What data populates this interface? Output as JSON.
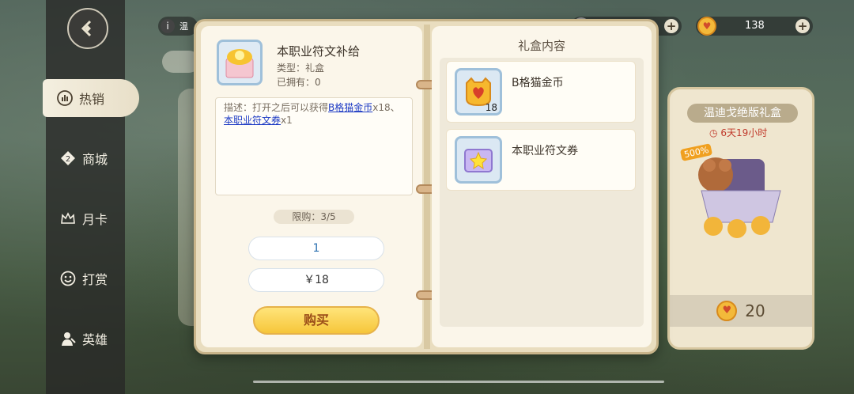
{
  "sidebar": {
    "items": [
      {
        "label": "热销",
        "icon": "bar-chart-icon",
        "active": true
      },
      {
        "label": "商城",
        "icon": "tag-icon",
        "active": false
      },
      {
        "label": "月卡",
        "icon": "crown-icon",
        "active": false
      },
      {
        "label": "打赏",
        "icon": "smile-coin-icon",
        "active": false
      },
      {
        "label": "英雄",
        "icon": "hero-icon",
        "active": false
      }
    ]
  },
  "topbar": {
    "info_text": "温",
    "currency_value": "138"
  },
  "gift_card": {
    "title": "温迪戈绝版礼盒",
    "timer": "6天19小时",
    "badge": "500%",
    "price": "20"
  },
  "item": {
    "name": "本职业符文补给",
    "type": "类型：礼盒",
    "owned": "已拥有：0",
    "desc_prefix": "描述：打开之后可以获得",
    "desc_link1": "B格猫金币",
    "desc_mid": "x18、",
    "desc_link2": "本职业符文券",
    "desc_suffix": "x1",
    "limit": "限购：3/5",
    "quantity": "1",
    "price": "￥18",
    "buy_label": "购买"
  },
  "contents": {
    "title": "礼盒内容",
    "rewards": [
      {
        "name": "B格猫金币",
        "qty": "18",
        "icon": "cat-coin-icon"
      },
      {
        "name": "本职业符文券",
        "qty": "",
        "icon": "star-ticket-icon"
      }
    ]
  },
  "colors": {
    "accent": "#f6c63a",
    "link": "#1d3ac4"
  }
}
